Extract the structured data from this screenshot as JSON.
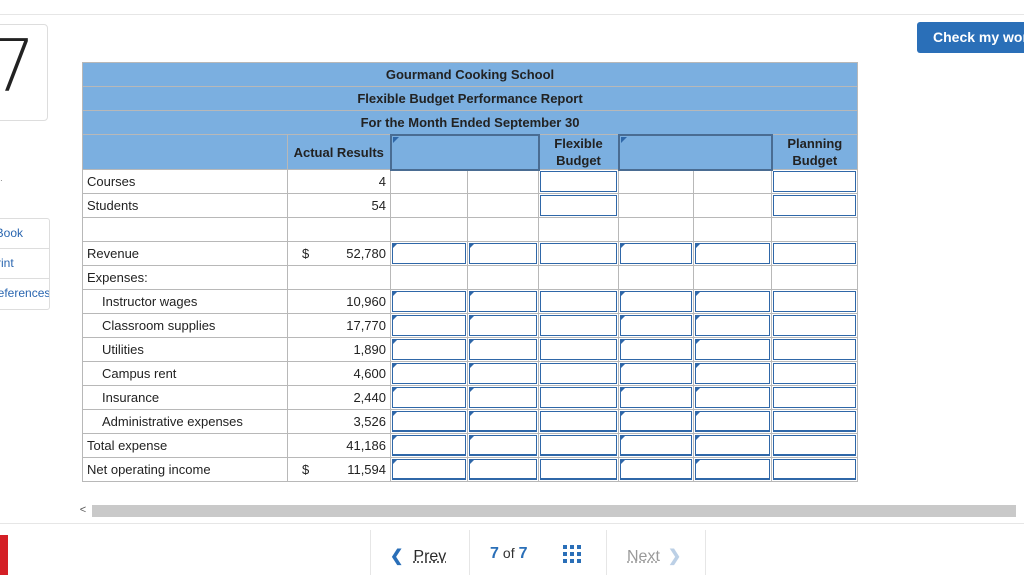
{
  "question": {
    "number": "7"
  },
  "sidebar": {
    "items": [
      "eBook",
      "Print",
      "References"
    ]
  },
  "check_button": {
    "label": "Check my work"
  },
  "report": {
    "title": "Gourmand Cooking School",
    "subtitle": "Flexible Budget Performance Report",
    "period": "For the Month Ended September 30",
    "columns": {
      "actual": "Actual Results",
      "flexible": "Flexible Budget",
      "planning": "Planning Budget"
    },
    "currency": "$",
    "rows": {
      "courses": {
        "label": "Courses",
        "actual": "4"
      },
      "students": {
        "label": "Students",
        "actual": "54"
      },
      "revenue": {
        "label": "Revenue",
        "actual": "52,780"
      },
      "expenses": {
        "label": "Expenses:"
      },
      "instructor_wages": {
        "label": "Instructor wages",
        "actual": "10,960"
      },
      "classroom_supplies": {
        "label": "Classroom supplies",
        "actual": "17,770"
      },
      "utilities": {
        "label": "Utilities",
        "actual": "1,890"
      },
      "campus_rent": {
        "label": "Campus rent",
        "actual": "4,600"
      },
      "insurance": {
        "label": "Insurance",
        "actual": "2,440"
      },
      "admin": {
        "label": "Administrative expenses",
        "actual": "3,526"
      },
      "total_expense": {
        "label": "Total expense",
        "actual": "41,186"
      },
      "net_income": {
        "label": "Net operating income",
        "actual": "11,594"
      }
    }
  },
  "pagination": {
    "prev": "Prev",
    "current": "7",
    "of": "of",
    "total": "7",
    "next": "Next"
  },
  "colors": {
    "header_blue": "#7bafe0",
    "accent": "#2a6fb8",
    "brand_red": "#d41f26"
  },
  "icons": {
    "grid": "grid-icon",
    "prev": "chevron-left-icon",
    "next": "chevron-right-icon"
  }
}
